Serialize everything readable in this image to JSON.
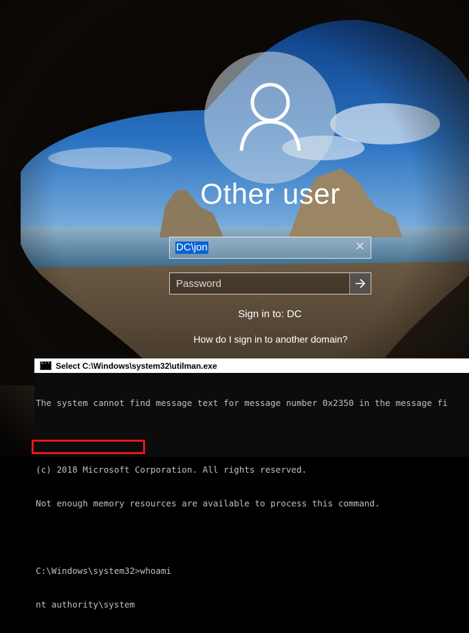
{
  "login": {
    "username_title": "Other user",
    "user_field_value": "DC\\jon",
    "password_placeholder": "Password",
    "clear_glyph": "✕",
    "sign_in_to": "Sign in to: DC",
    "help_link": "How do I sign in to another domain?"
  },
  "console": {
    "title": "Select C:\\Windows\\system32\\utilman.exe",
    "lines": [
      "The system cannot find message text for message number 0x2350 in the message fi",
      "",
      "(c) 2018 Microsoft Corporation. All rights reserved.",
      "Not enough memory resources are available to process this command.",
      "",
      "C:\\Windows\\system32>whoami",
      "nt authority\\system"
    ]
  },
  "colors": {
    "selection": "#0a64d2",
    "highlight_border": "#e8161b",
    "console_bg": "#0c0c0c",
    "console_text": "#c0c0c0"
  },
  "icons": {
    "avatar": "user-silhouette-icon",
    "submit": "arrow-right-icon",
    "clear": "close-icon",
    "console": "cmd-icon"
  }
}
